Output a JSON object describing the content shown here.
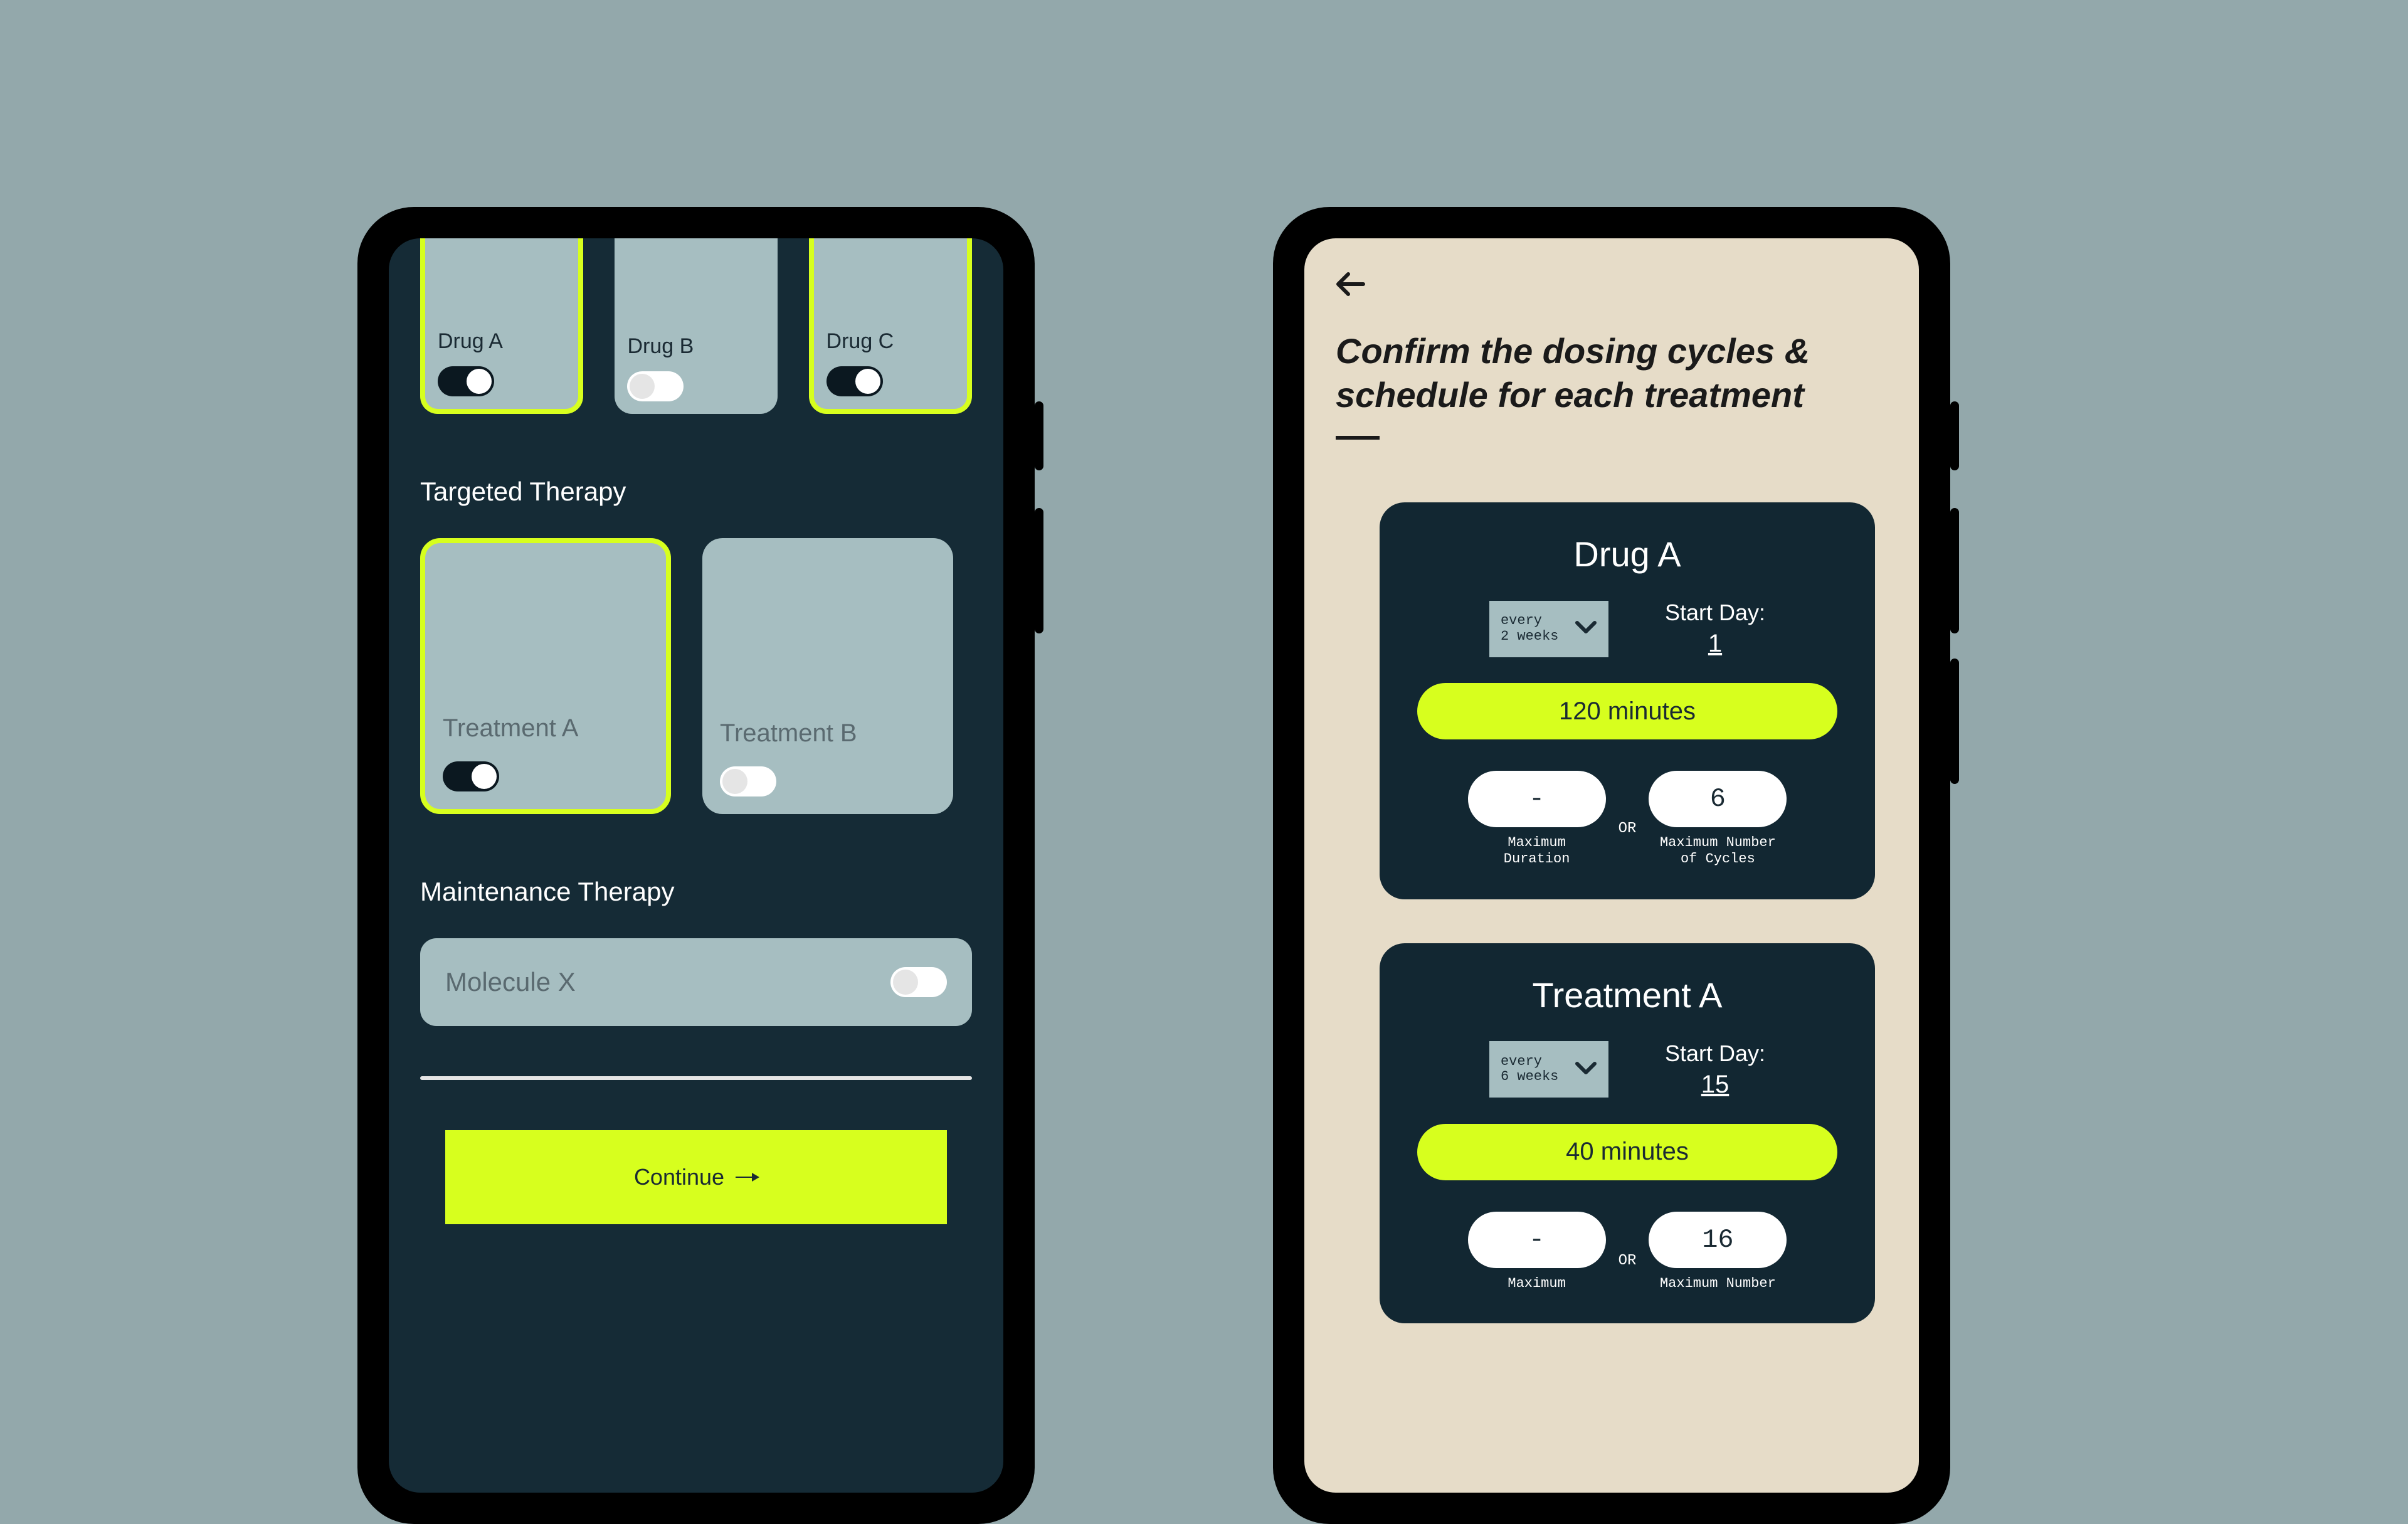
{
  "left": {
    "drugs": [
      {
        "label": "Drug A",
        "selected": true,
        "toggled": true
      },
      {
        "label": "Drug B",
        "selected": false,
        "toggled": false
      },
      {
        "label": "Drug C",
        "selected": true,
        "toggled": true
      }
    ],
    "section_targeted": "Targeted Therapy",
    "treatments": [
      {
        "label": "Treatment A",
        "selected": true,
        "toggled": true
      },
      {
        "label": "Treatment B",
        "selected": false,
        "toggled": false
      }
    ],
    "section_maintenance": "Maintenance Therapy",
    "molecule": {
      "label": "Molecule X",
      "toggled": false
    },
    "continue_label": "Continue"
  },
  "right": {
    "heading": "Confirm the dosing cycles & schedule for each treatment",
    "cards": [
      {
        "title": "Drug A",
        "frequency": "every\n2 weeks",
        "start_day_label": "Start Day:",
        "start_day_value": "1",
        "duration": "120 minutes",
        "max_duration_value": "-",
        "max_duration_label": "Maximum\nDuration",
        "or": "OR",
        "max_cycles_value": "6",
        "max_cycles_label": "Maximum Number\nof Cycles"
      },
      {
        "title": "Treatment A",
        "frequency": "every\n6 weeks",
        "start_day_label": "Start Day:",
        "start_day_value": "15",
        "duration": "40 minutes",
        "max_duration_value": "-",
        "max_duration_label": "Maximum",
        "or": "OR",
        "max_cycles_value": "16",
        "max_cycles_label": "Maximum Number"
      }
    ]
  }
}
